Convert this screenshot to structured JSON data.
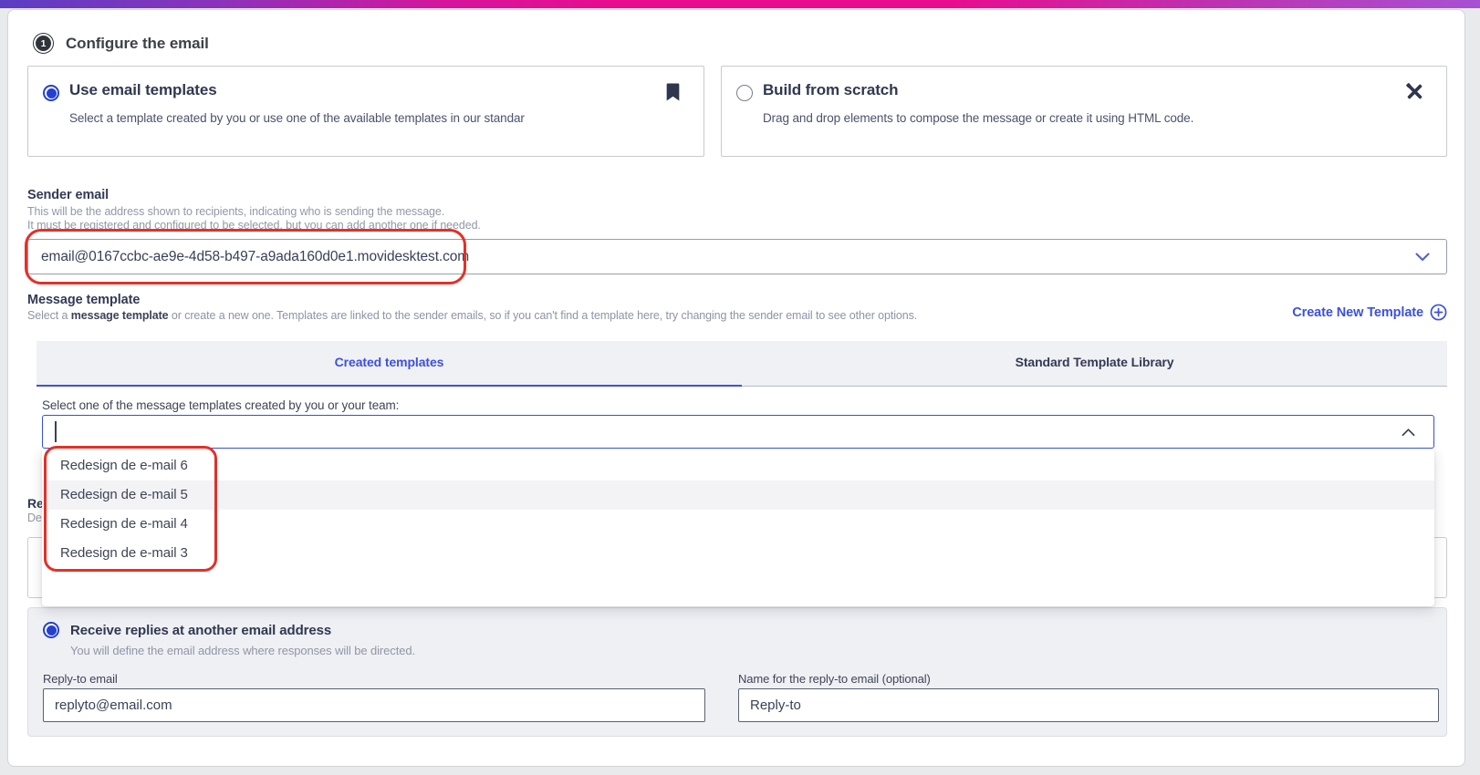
{
  "step": {
    "number": "1",
    "title": "Configure the email"
  },
  "template_source_options": [
    {
      "title": "Use email templates",
      "description": "Select a template created by you or use one of the available templates in our standar",
      "selected": true,
      "icon": "bookmark-icon"
    },
    {
      "title": "Build from scratch",
      "description": "Drag and drop elements to compose the message or create it using HTML code.",
      "selected": false,
      "icon": "tools-icon"
    }
  ],
  "sender_email": {
    "label": "Sender email",
    "description_line1": "This will be the address shown to recipients, indicating who is sending the message.",
    "description_line2": "It must be registered and configured to be selected, but you can add another one if needed.",
    "selected_value": "email@0167ccbc-ae9e-4d58-b497-a9ada160d0e1.movidesktest.com"
  },
  "message_template": {
    "label": "Message template",
    "description_prefix": "Select a ",
    "description_bold": "message template",
    "description_suffix": " or create a new one. Templates are linked to the sender emails, so if you can't find a template here, try changing the sender email to see other options.",
    "create_new_link": "Create New Template",
    "tabs": [
      {
        "label": "Created templates",
        "active": true
      },
      {
        "label": "Standard Template Library",
        "active": false
      }
    ],
    "select_label": "Select one of the message templates created by you or your team:",
    "search_value": "",
    "options": [
      "Redesign de e-mail 6",
      "Redesign de e-mail 5",
      "Redesign de e-mail 4",
      "Redesign de e-mail 3"
    ],
    "highlighted_option": "Redesign de e-mail 5"
  },
  "replies": {
    "covered_heading_fragment": "Re",
    "covered_description_fragment": "De",
    "receive_other_option": {
      "title": "Receive replies at another email address",
      "description": "You will define the email address where responses will be directed.",
      "selected": true
    },
    "reply_to_email": {
      "label": "Reply-to email",
      "value": "replyto@email.com"
    },
    "reply_to_name": {
      "label": "Name for the reply-to email (optional)",
      "value": "Reply-to"
    }
  },
  "colors": {
    "accent_blue": "#3c50e0",
    "radio_blue": "#2440d2",
    "annotation_red": "#e43028",
    "gradient_left": "#5b3ec3",
    "gradient_middle": "#e90c8e",
    "gradient_right": "#a751d3"
  }
}
